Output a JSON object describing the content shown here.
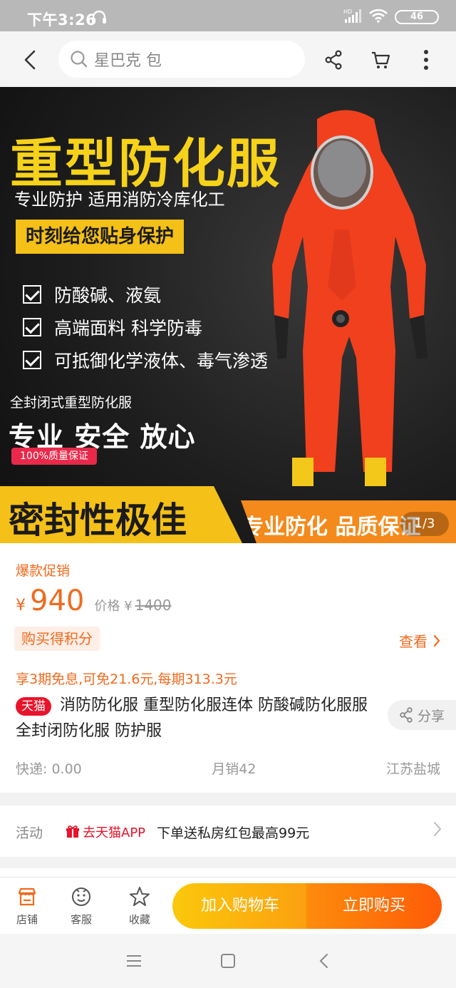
{
  "status_bar": {
    "time": "下午3:26",
    "battery": "46",
    "network": "HD"
  },
  "header": {
    "search_placeholder": "星巴克 包",
    "icons": [
      "back-arrow-icon",
      "search-icon",
      "share-icon",
      "cart-icon",
      "more-icon"
    ]
  },
  "banner": {
    "title": "重型防化服",
    "subtitle": "专业防护 适用消防冷库化工",
    "tagline": "时刻给您贴身保护",
    "features": [
      "防酸碱、液氨",
      "高端面料 科学防毒",
      "可抵御化学液体、毒气渗透"
    ],
    "seal_line": "全封闭式重型防化服",
    "slogan": "专业 安全 放心",
    "quality_badge": "100%质量保证",
    "bottom_left": "密封性极佳",
    "bottom_right": "专业防化 品质保证",
    "page_indicator": "1/3",
    "colors": {
      "suit": "#f0401e",
      "yellow": "#f5c017",
      "orange": "#f48a1b"
    }
  },
  "product": {
    "promo_label": "爆款促销",
    "currency": "¥",
    "price": "940",
    "original_price_label": "价格 ¥",
    "original_price": "1400",
    "points_badge": "购买得积分",
    "view_link": "查看",
    "installment": "享3期免息,可免21.6元,每期313.3元",
    "tmall_badge": "天猫",
    "title": "消防防化服 重型防化服连体 防酸碱防化服服 全封闭防化服 防护服",
    "share_label": "分享",
    "shipping": "快递: 0.00",
    "monthly_sales": "月销42",
    "location": "江苏盐城"
  },
  "activity": {
    "label": "活动",
    "app_tag": "去天猫APP",
    "description": "下单送私房红包最高99元"
  },
  "action_bar": {
    "store_label": "店铺",
    "service_label": "客服",
    "favorite_label": "收藏",
    "add_to_cart": "加入购物车",
    "buy_now": "立即购买",
    "accent": "#f06a1e"
  }
}
